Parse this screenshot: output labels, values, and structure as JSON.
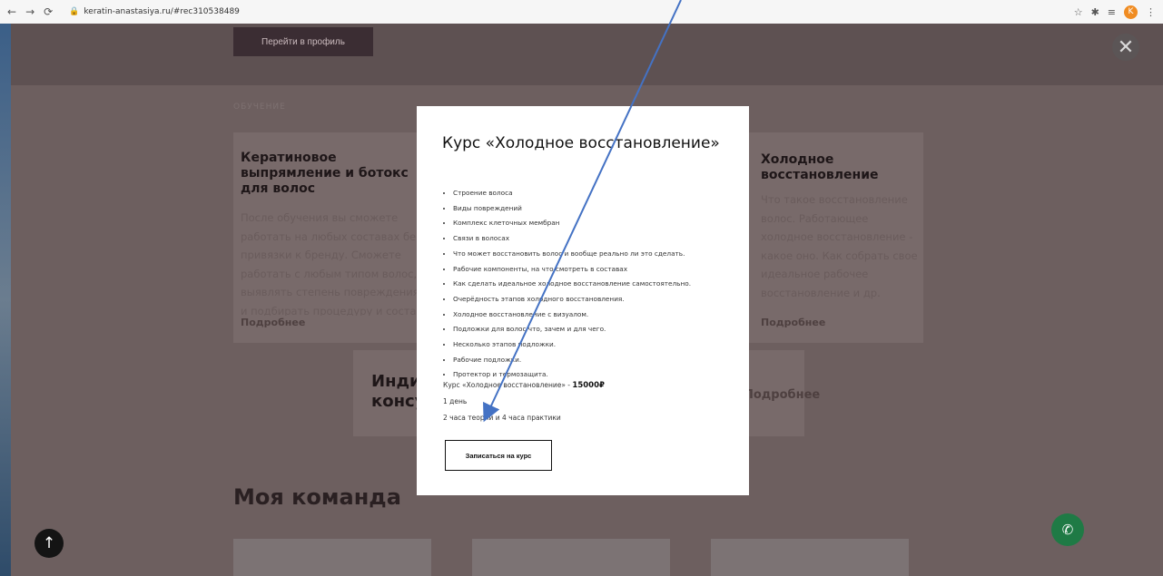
{
  "browser": {
    "url": "keratin-anastasiya.ru/#rec310538489",
    "profile_letter": "K"
  },
  "page": {
    "profile_button": "Перейти в профиль",
    "section_label": "ОБУЧЕНИЕ",
    "card_left": {
      "title": "Кератиновое выпрямление и ботокс для волос",
      "text": "После обучения вы сможете работать на любых составах без привязки к бренду. Сможете работать с любым типом волос, выявлять степень повреждения и подбирать процедуру и состав.",
      "more": "Подробнее"
    },
    "card_right": {
      "title": "Холодное восстановление",
      "text": "Что такое восстановление волос. Работающее холодное восстановление - какое оно. Как собрать свое идеальное рабочее восстановление и др.",
      "more": "Подробнее"
    },
    "card_bottom": {
      "title": "Индивидуальная консультация",
      "more": "Подробнее"
    },
    "team_title": "Моя команда"
  },
  "modal": {
    "title": "Курс «Холодное восстановление»",
    "items": [
      "Строение волоса",
      "Виды повреждений",
      "Комплекс клеточных мембран",
      "Связи в волосах",
      "Что может восстановить волос и вообще реально ли это сделать.",
      "Рабочие компоненты, на что смотреть в составах",
      "Как сделать идеальное холодное восстановление самостоятельно.",
      "Очерёдность этапов холодного восстановления.",
      "Холодное восстановление с визуалом.",
      "Подложки для волос что, зачем и для чего.",
      "Несколько этапов подложки.",
      "Рабочие подложки.",
      "Протектор и термозащита."
    ],
    "price_label": "Курс «Холодное восстановление» - ",
    "price_value": "15000₽",
    "duration": "1 день",
    "hours": "2 часа теории и 4 часа практики",
    "enroll_button": "Записаться на курс"
  },
  "colors": {
    "overlay_bg": "#6b5e5e",
    "modal_bg": "#ffffff",
    "arrow": "#4472c4",
    "call_button": "#1f7a45"
  }
}
